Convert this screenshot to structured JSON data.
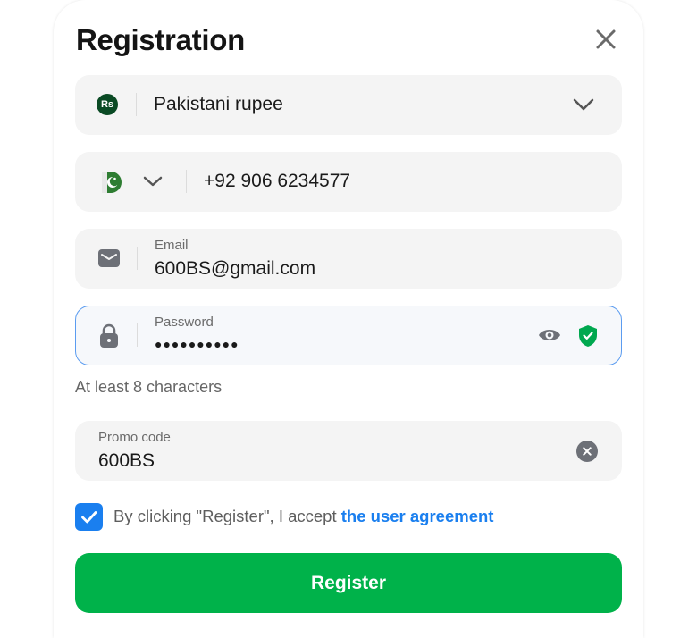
{
  "dialog": {
    "title": "Registration"
  },
  "currency": {
    "badge": "Rs",
    "value": "Pakistani rupee"
  },
  "phone": {
    "value": "+92 906 6234577"
  },
  "email": {
    "label": "Email",
    "value": "600BS@gmail.com"
  },
  "password": {
    "label": "Password",
    "masked_value": "●●●●●●●●●●",
    "hint": "At least 8 characters"
  },
  "promo": {
    "label": "Promo code",
    "value": "600BS"
  },
  "agreement": {
    "checked": true,
    "text": "By clicking \"Register\", I accept ",
    "link": "the user agreement"
  },
  "register": {
    "label": "Register"
  },
  "colors": {
    "accent_blue": "#1a7fef",
    "register_green": "#00b24a",
    "shield_green": "#00a84f",
    "currency_badge": "#0a4a24"
  }
}
